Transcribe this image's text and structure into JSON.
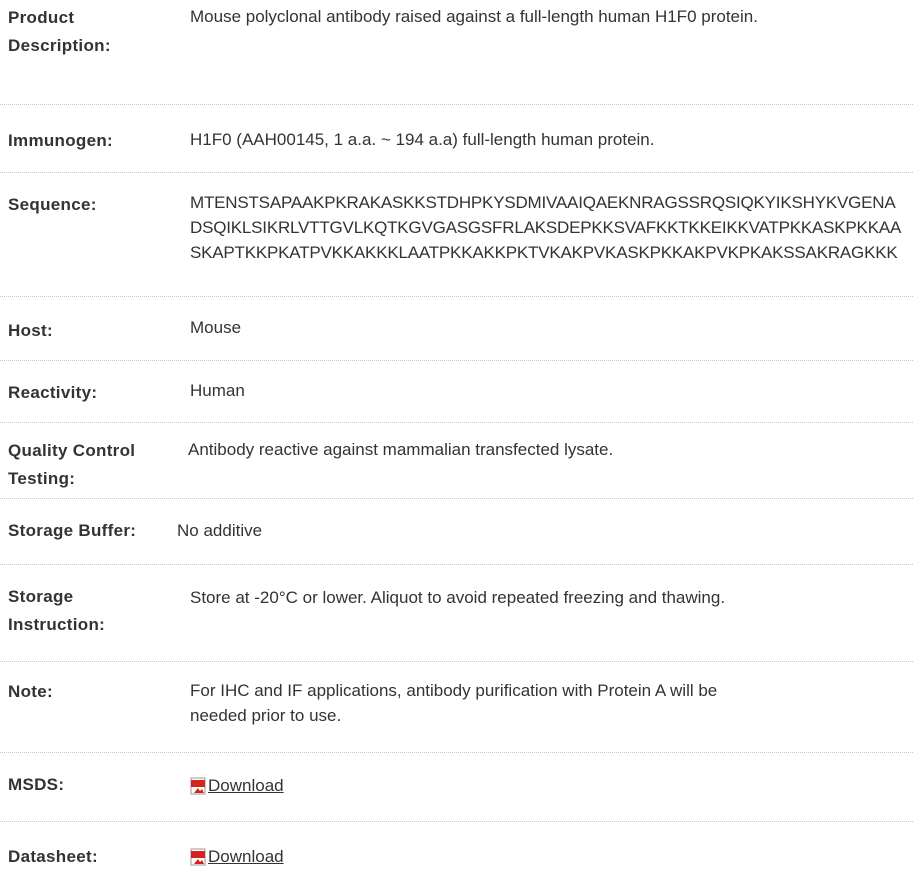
{
  "spec_rows": [
    {
      "label": "Product Description:",
      "value": "Mouse polyclonal antibody raised against a full-length human H1F0 protein."
    },
    {
      "label": "Immunogen:",
      "value": "H1F0 (AAH00145, 1 a.a. ~ 194 a.a) full-length human protein."
    },
    {
      "label": "Sequence:",
      "value": "MTENSTSAPAAKPKRAKASKKSTDHPKYSDMIVAAIQAEKNRAGSSRQSIQKYIKSHYKVGENADSQIKLSIKRLVTTGVLKQTKGVGASGSFRLAKSDEPKKSVAFKKTKKEIKKVATPKKASKPKKAASKAPTKKPKATPVKKAKKKLAATPKKAKKPKTVKAKPVKASKPKKAKPVKPKAKSSAKRAGKKK"
    },
    {
      "label": "Host:",
      "value": "Mouse"
    },
    {
      "label": "Reactivity:",
      "value": "Human"
    },
    {
      "label": "Quality Control Testing:",
      "value": "Antibody reactive against mammalian transfected lysate."
    },
    {
      "label": "Storage Buffer:",
      "value": "No additive"
    },
    {
      "label": "Storage Instruction:",
      "value": "Store at -20°C or lower. Aliquot to avoid repeated freezing and thawing."
    },
    {
      "label": "Note:",
      "value": "For IHC and IF applications, antibody purification with Protein A will be needed prior to use."
    },
    {
      "label": "MSDS:",
      "link": "Download",
      "icon": "pdf-file-icon"
    },
    {
      "label": "Datasheet:",
      "link": "Download",
      "icon": "pdf-file-icon"
    }
  ],
  "colors": {
    "text": "#333333",
    "divider": "#c8c8c8",
    "pdf_red": "#d4241c"
  }
}
